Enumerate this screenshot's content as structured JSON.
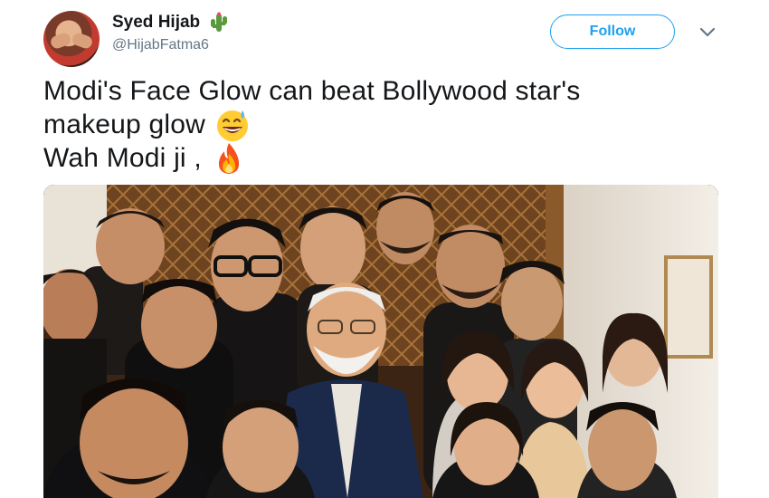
{
  "author": {
    "display_name": "Syed Hijab",
    "handle": "@HijabFatma6",
    "name_emoji": "cactus-icon"
  },
  "actions": {
    "follow_label": "Follow",
    "more_icon": "chevron-down-icon"
  },
  "tweet": {
    "lines": [
      "Modi's Face Glow can beat Bollywood star's",
      "makeup glow",
      "Wah Modi ji ,"
    ],
    "emojis": [
      "grinning-sweat-emoji",
      "fire-emoji"
    ]
  },
  "media": {
    "type": "photo",
    "icon": "group-selfie-photo"
  },
  "colors": {
    "accent": "#1da1f2",
    "text": "#14171a",
    "muted": "#657786"
  }
}
